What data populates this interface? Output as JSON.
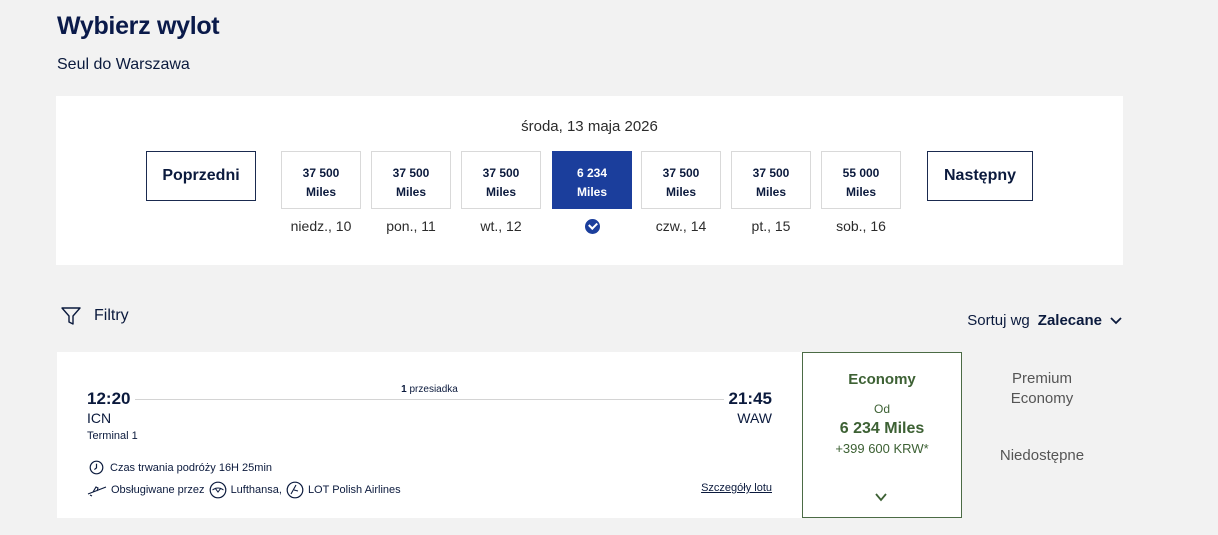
{
  "header": {
    "title": "Wybierz wylot",
    "route": "Seul do Warszawa"
  },
  "date_selector": {
    "selected_date": "środa, 13 maja 2026",
    "prev_label": "Poprzedni",
    "next_label": "Następny",
    "days": [
      {
        "price": "37 500",
        "unit": "Miles",
        "label": "niedz., 10"
      },
      {
        "price": "37 500",
        "unit": "Miles",
        "label": "pon., 11"
      },
      {
        "price": "37 500",
        "unit": "Miles",
        "label": "wt., 12"
      },
      {
        "price": "6 234",
        "unit": "Miles",
        "label": ""
      },
      {
        "price": "37 500",
        "unit": "Miles",
        "label": "czw., 14"
      },
      {
        "price": "37 500",
        "unit": "Miles",
        "label": "pt., 15"
      },
      {
        "price": "55 000",
        "unit": "Miles",
        "label": "sob., 16"
      }
    ]
  },
  "toolbar": {
    "filters_label": "Filtry",
    "sort_label": "Sortuj wg",
    "sort_value": "Zalecane"
  },
  "flight": {
    "departure_time": "12:20",
    "departure_code": "ICN",
    "terminal": "Terminal 1",
    "stops_count": "1",
    "stops_label": "przesiadka",
    "arrival_time": "21:45",
    "arrival_code": "WAW",
    "duration": "Czas trwania podróży 16H 25min",
    "operated_by": "Obsługiwane przez",
    "airline_1": "Lufthansa,",
    "airline_2": "LOT Polish Airlines",
    "details_link": "Szczegóły lotu"
  },
  "economy": {
    "name": "Economy",
    "from_label": "Od",
    "miles": "6 234 Miles",
    "krw": "+399 600 KRW*"
  },
  "premium": {
    "name_line1": "Premium",
    "name_line2": "Economy",
    "status": "Niedostępne"
  },
  "colors": {
    "brand_blue": "#1b3e9c",
    "economy_green": "#3d6134",
    "navy": "#0b1a3d"
  }
}
